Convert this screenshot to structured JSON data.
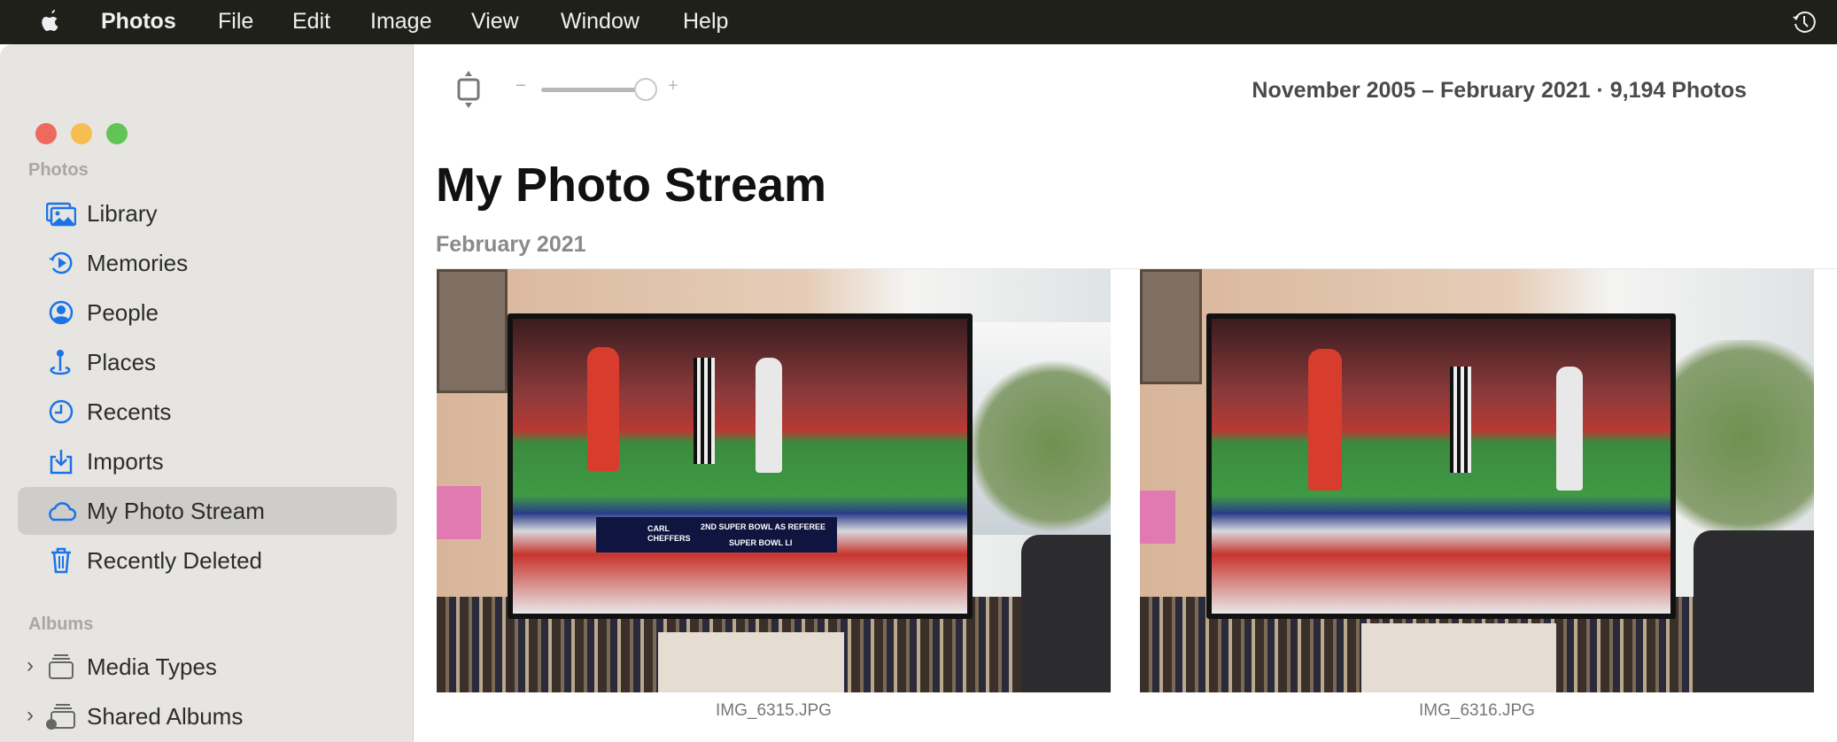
{
  "menubar": {
    "app": "Photos",
    "items": [
      "File",
      "Edit",
      "Image",
      "View",
      "Window",
      "Help"
    ],
    "apple_icon": "apple-logo-icon",
    "right_icon": "time-machine-icon"
  },
  "sidebar": {
    "photos_header": "Photos",
    "items": [
      {
        "label": "Library",
        "icon": "library-icon"
      },
      {
        "label": "Memories",
        "icon": "memories-icon"
      },
      {
        "label": "People",
        "icon": "people-icon"
      },
      {
        "label": "Places",
        "icon": "places-icon"
      },
      {
        "label": "Recents",
        "icon": "recents-icon"
      },
      {
        "label": "Imports",
        "icon": "imports-icon"
      },
      {
        "label": "My Photo Stream",
        "icon": "cloud-icon",
        "selected": true
      },
      {
        "label": "Recently Deleted",
        "icon": "trash-icon"
      }
    ],
    "albums_header": "Albums",
    "albums": [
      {
        "label": "Media Types",
        "icon": "media-types-icon"
      },
      {
        "label": "Shared Albums",
        "icon": "shared-albums-icon"
      }
    ]
  },
  "toolbar": {
    "zoom_minus": "−",
    "zoom_plus": "+",
    "zoom_level": 1.0,
    "range": "November 2005 – February 2021 · 9,194 Photos"
  },
  "main": {
    "title": "My Photo Stream",
    "section": "February 2021",
    "photos": [
      {
        "filename": "IMG_6315.JPG",
        "chyron": {
          "name": "CARL CHEFFERS",
          "line1": "2ND SUPER BOWL AS REFEREE",
          "line2": "SUPER BOWL LI"
        }
      },
      {
        "filename": "IMG_6316.JPG"
      }
    ]
  },
  "colors": {
    "accent": "#1a73e8",
    "menubar": "#1f201a",
    "sidebar": "#e7e5e1",
    "selected": "#cfcdca"
  }
}
